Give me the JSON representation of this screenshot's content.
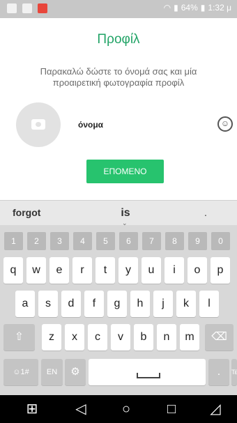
{
  "status_bar": {
    "battery": "64%",
    "time": "1:32 μ"
  },
  "screen": {
    "title": "Προφίλ",
    "subtitle": "Παρακαλώ δώστε το όνομά σας και μία προαιρετική φωτογραφία προφίλ",
    "name_value": "όνομα",
    "next_label": "ΕΠΟΜΕΝΟ",
    "emoji_icon": "☺"
  },
  "keyboard": {
    "suggestions": [
      "forgot",
      "is",
      "."
    ],
    "numbers": [
      "1",
      "2",
      "3",
      "4",
      "5",
      "6",
      "7",
      "8",
      "9",
      "0"
    ],
    "row1": [
      "q",
      "w",
      "e",
      "r",
      "t",
      "y",
      "u",
      "i",
      "ο",
      "p"
    ],
    "row2": [
      "a",
      "s",
      "d",
      "f",
      "g",
      "h",
      "j",
      "k",
      "l"
    ],
    "row3": [
      "z",
      "x",
      "c",
      "v",
      "b",
      "n",
      "m"
    ],
    "shift_icon": "⇧",
    "delete_icon": "⌫",
    "emoji_key": "☺1#",
    "lang_key": "EN",
    "settings_icon": "⚙",
    "period_key": ".",
    "enter_key": "Τέλος"
  },
  "nav": {
    "icons": [
      "⊞",
      "◁",
      "○",
      "□",
      "◿"
    ]
  }
}
